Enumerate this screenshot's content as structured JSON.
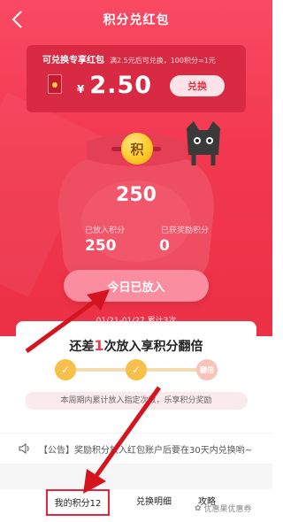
{
  "header": {
    "title": "积分兑红包"
  },
  "card": {
    "title": "可兑换专享红包",
    "subtitle": "满2.5元后可兑换，100积分=1元",
    "currency": "¥",
    "amount": "2.50",
    "exchange_label": "兑换"
  },
  "jar": {
    "coin_char": "积",
    "points": "250",
    "placed_label": "已放入积分",
    "reward_label": "已获奖励积分",
    "placed_value": "250",
    "reward_value": "0"
  },
  "action": {
    "placed_button": "今日已放入",
    "date_range": "01/21-01/27 累计3次"
  },
  "progress": {
    "prefix": "还差",
    "count": "1",
    "suffix": "次放入享积分翻倍",
    "step3_label": "翻倍",
    "rule_text": "本周期内累计放入指定次数，乐享积分奖励"
  },
  "notice": {
    "text": "【公告】奖励积分放入红包账户后要在30天内兑换哟~"
  },
  "tabs": {
    "my_points": "我的积分12",
    "exchange_detail": "兑换明细",
    "guide": "攻略"
  },
  "watermark": "优惠果优惠券",
  "colors": {
    "primary_red": "#f2384f",
    "gold": "#f6c04a",
    "highlight": "#e8233c"
  }
}
